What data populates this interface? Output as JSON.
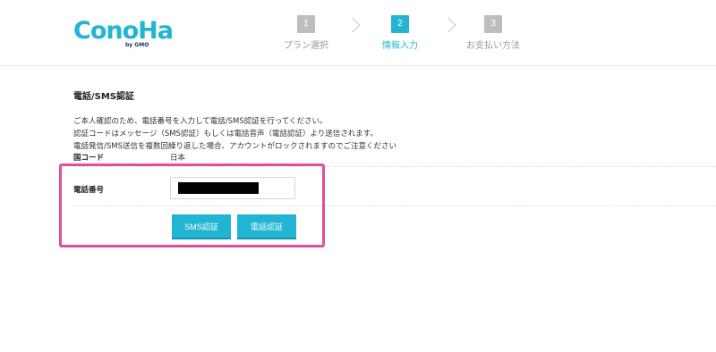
{
  "header": {
    "logo_text": "ConoHa",
    "logo_sub": "by GMO",
    "steps": [
      {
        "number": "1",
        "label": "プラン選択"
      },
      {
        "number": "2",
        "label": "情報入力"
      },
      {
        "number": "3",
        "label": "お支払い方法"
      }
    ],
    "active_step": 2
  },
  "main": {
    "title": "電話/SMS認証",
    "description": [
      "ご本人確認のため、電話番号を入力して電話/SMS認証を行ってください。",
      "認証コードはメッセージ（SMS認証）もしくは電話音声（電話認証）より送信されます。",
      "電話発信/SMS送信を複数回繰り返した場合、アカウントがロックされますのでご注意ください"
    ],
    "country_label": "国コード",
    "country_value": "日本",
    "phone_label": "電話番号",
    "phone_value": "",
    "sms_button": "SMS認証",
    "call_button": "電話認証"
  },
  "colors": {
    "accent": "#21b5d3",
    "highlight": "#e04f9b",
    "inactive_step": "#bdbdbd"
  }
}
